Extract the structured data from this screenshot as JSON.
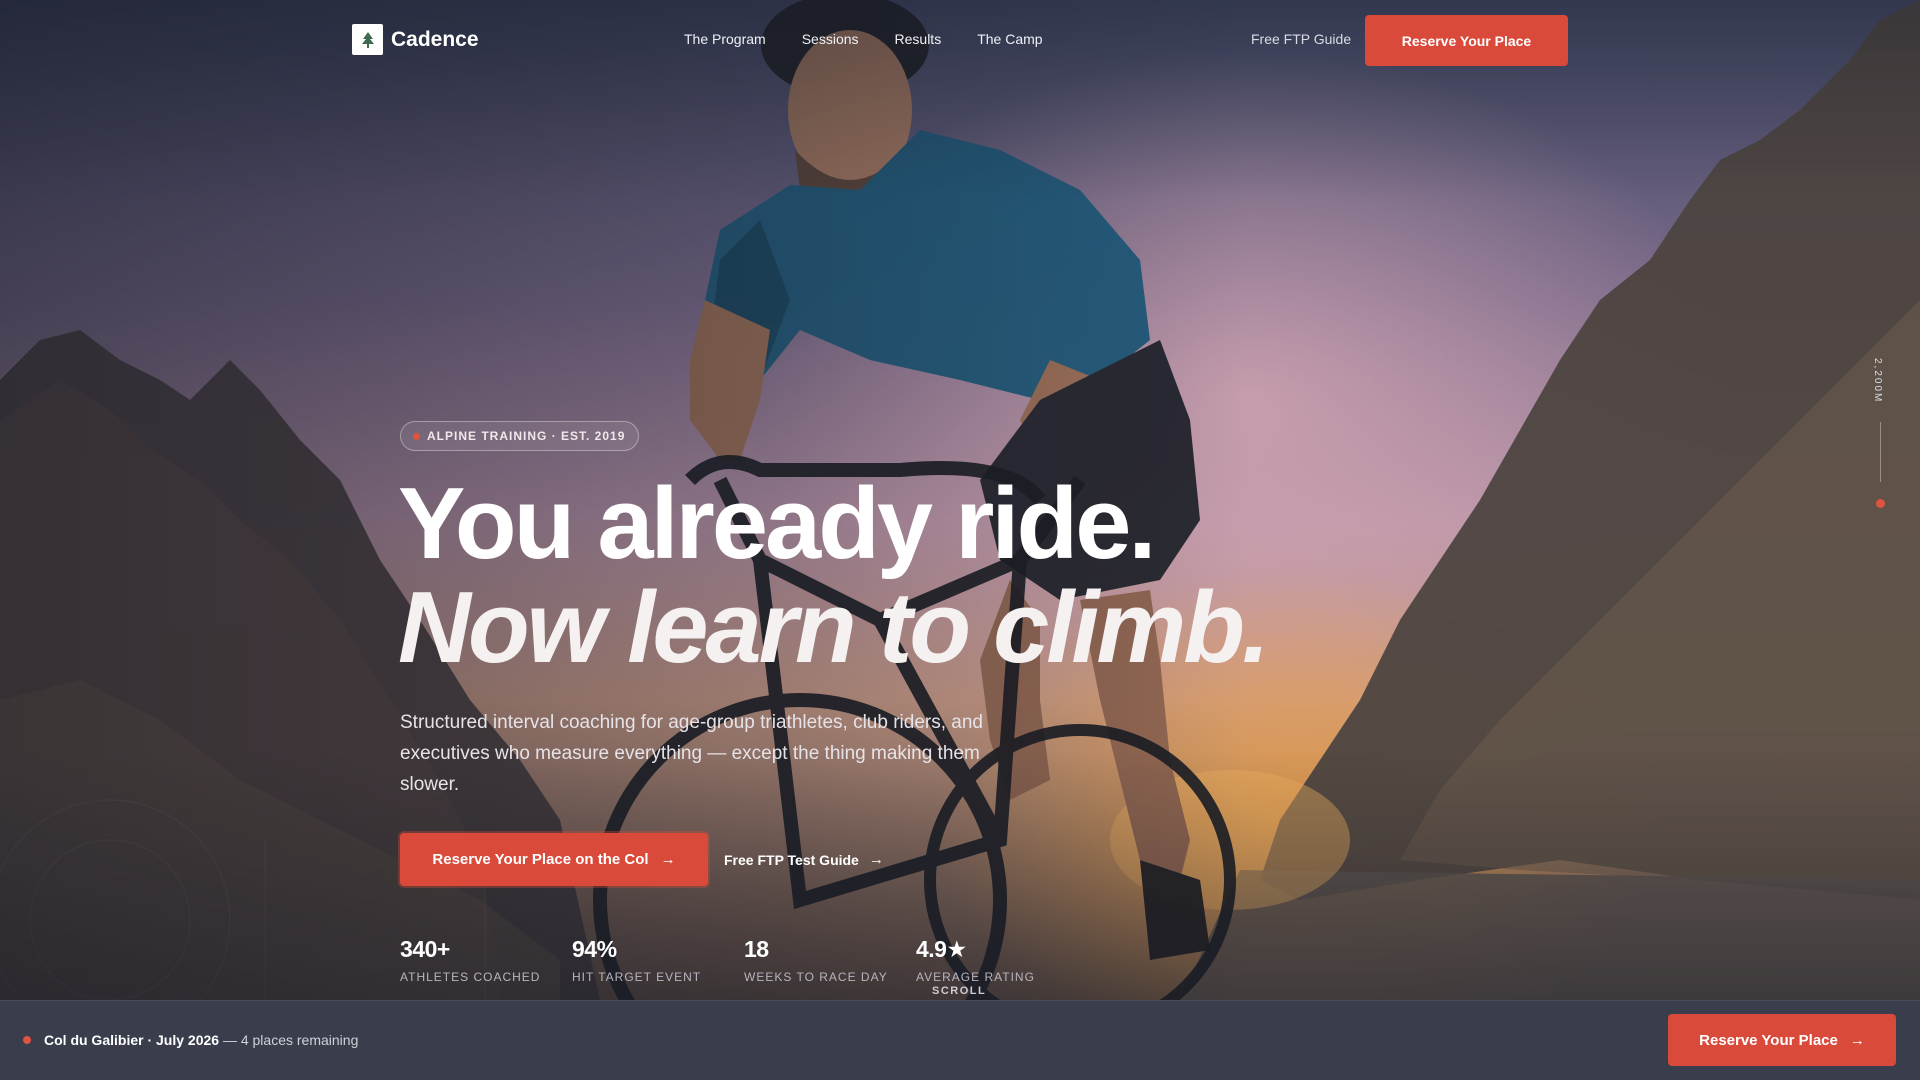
{
  "brand": {
    "name": "Cadence",
    "logo_icon": "tree-icon"
  },
  "nav": {
    "links": [
      "The Program",
      "Sessions",
      "Results",
      "The Camp"
    ],
    "guide_link": "Free FTP Guide",
    "cta": "Reserve Your Place"
  },
  "hero": {
    "badge": "ALPINE TRAINING · EST. 2019",
    "headline_line1": "You already ride.",
    "headline_line2": "Now learn to climb.",
    "subcopy": "Structured interval coaching for age-group triathletes, club riders, and executives who measure everything — except the thing making them slower.",
    "primary_cta": "Reserve Your Place on the Col",
    "secondary_cta": "Free FTP Test Guide"
  },
  "stats": [
    {
      "value": "340+",
      "label": "ATHLETES COACHED"
    },
    {
      "value": "94%",
      "label": "HIT TARGET EVENT"
    },
    {
      "value": "18",
      "label": "WEEKS TO RACE DAY"
    },
    {
      "value": "4.9★",
      "label": "AVERAGE RATING"
    }
  ],
  "scroll_label": "SCROLL",
  "altitude_label": "2,200M",
  "bottom_bar": {
    "event": "Col du Galibier · July 2026",
    "availability": "— 4 places remaining",
    "cta": "Reserve Your Place"
  },
  "colors": {
    "accent": "#d94a3a",
    "bottom_bar": "#3a3d4c"
  },
  "icons": {
    "arrow": "arrow-right-icon",
    "status_dot": "status-dot-icon"
  }
}
